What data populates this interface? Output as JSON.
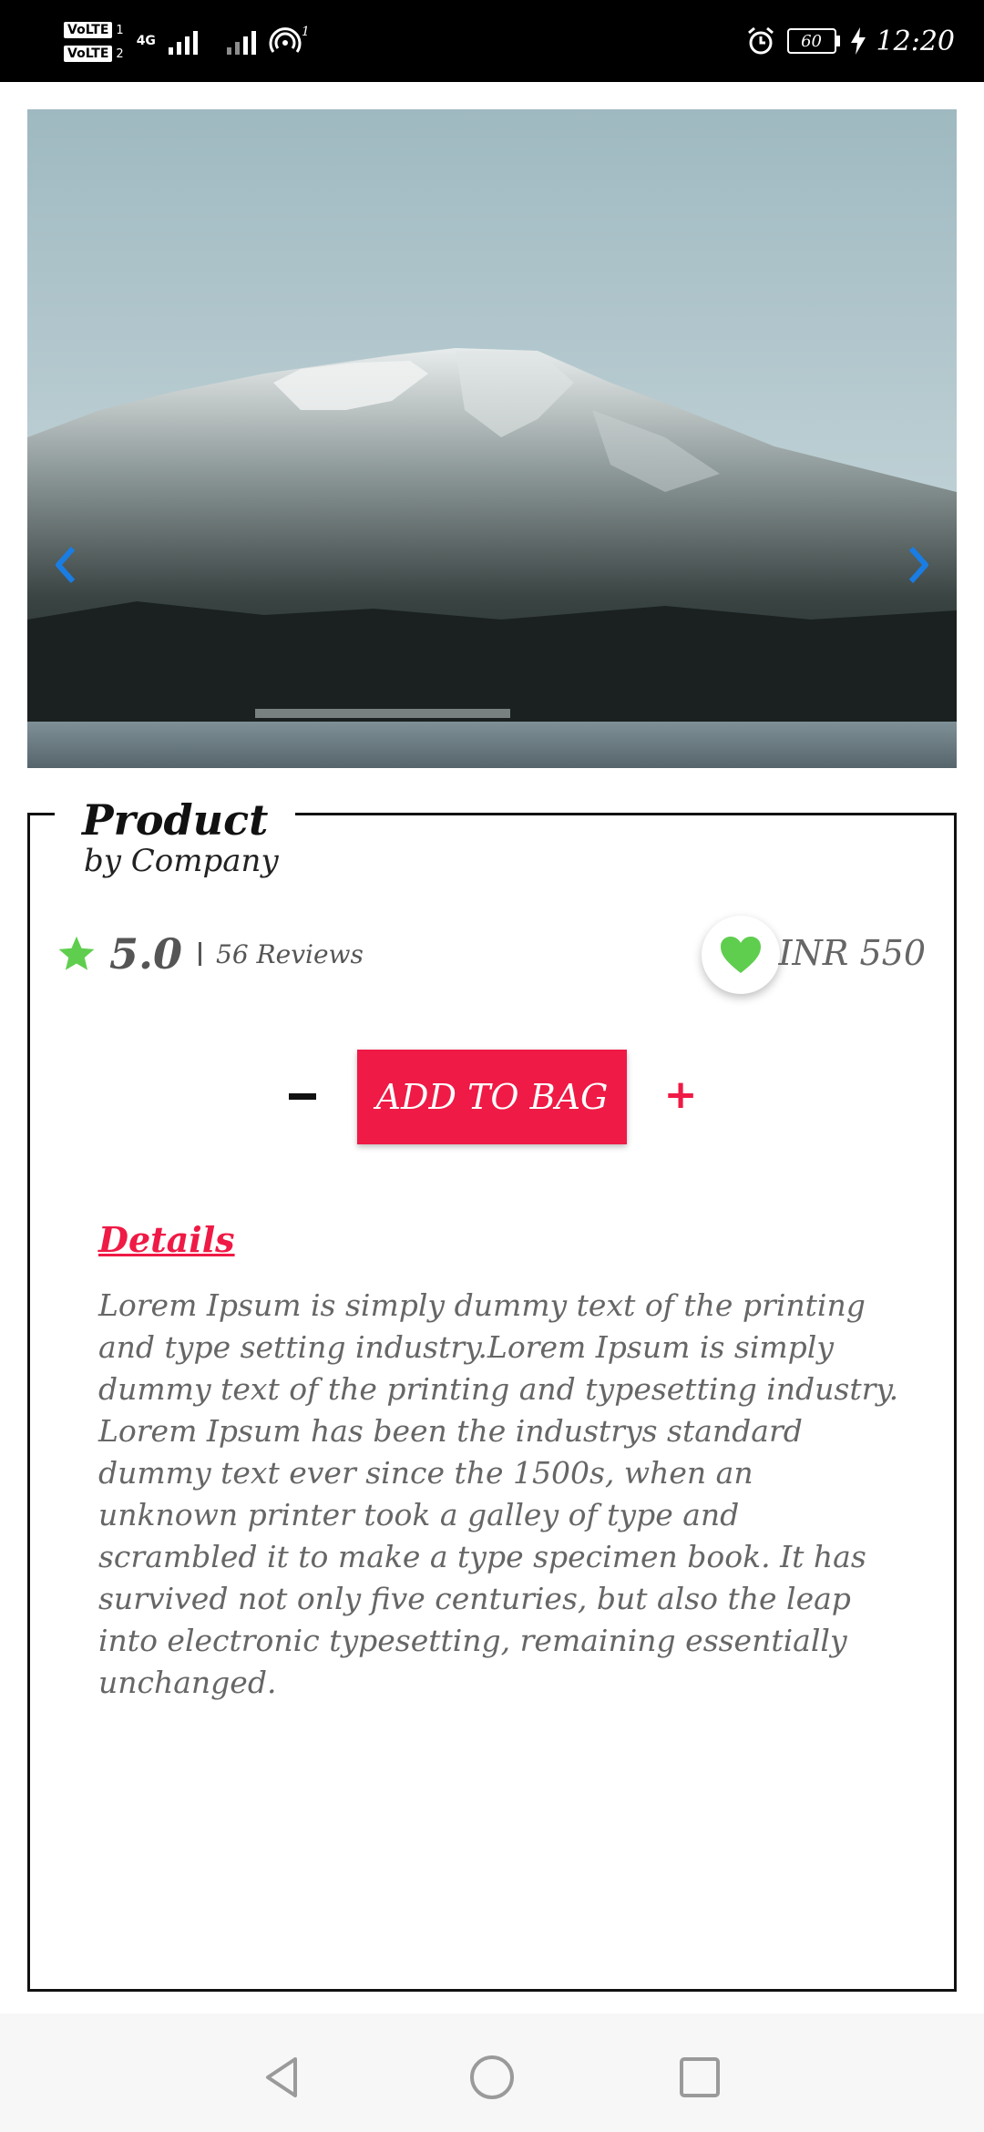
{
  "status_bar": {
    "sim1": "VoLTE",
    "sim1_slot": "1",
    "sim2": "VoLTE",
    "sim2_slot": "2",
    "network": "4G",
    "hotspot_count": "1",
    "battery": "60",
    "time": "12:20"
  },
  "carousel": {
    "image": "mountain-landscape-photo",
    "prev_icon": "chevron-left-icon",
    "next_icon": "chevron-right-icon",
    "slide_count": 5,
    "active_index": 2,
    "arrow_color": "#1a7de3"
  },
  "product": {
    "title": "Product",
    "company": "by Company",
    "rating": "5.0",
    "reviews": "56 Reviews",
    "price": "INR 550",
    "favorite_icon": "heart-icon",
    "star_icon": "star-icon"
  },
  "actions": {
    "decrease": "decrease-quantity",
    "add_to_bag": "ADD TO BAG",
    "increase": "+"
  },
  "details": {
    "heading": "Details",
    "body": " Lorem Ipsum is simply dummy text of the printing and type setting industry.Lorem Ipsum is simply dummy text of the printing and typesetting industry. Lorem Ipsum has been the industrys standard dummy text ever since the 1500s, when an unknown printer took a galley of type and scrambled it to make a type specimen book. It has survived not only five centuries, but also the leap into electronic typesetting, remaining essentially unchanged."
  },
  "colors": {
    "accent": "#ef1a45",
    "favorite": "#5fce4e",
    "star": "#5fce4e",
    "status_bar": "#000000"
  },
  "nav_bar": {
    "back_icon": "back-triangle-icon",
    "home_icon": "home-circle-icon",
    "recent_icon": "recent-square-icon"
  }
}
